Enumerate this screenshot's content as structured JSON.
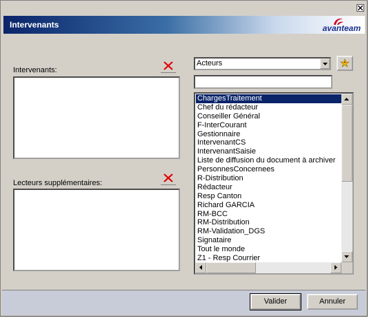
{
  "window": {
    "title": "Intervenants",
    "logo_text": "avanteam"
  },
  "left": {
    "intervenants_label": "Intervenants:",
    "lecteurs_label": "Lecteurs supplémentaires:",
    "intervenants_items": [],
    "lecteurs_items": []
  },
  "right": {
    "combo_value": "Acteurs",
    "filter_value": "",
    "selected_index": 0,
    "items": [
      "ChargesTraitement",
      "Chef du rédacteur",
      "Conseiller Général",
      "F-InterCourant",
      "Gestionnaire",
      "IntervenantCS",
      "IntervenantSaisie",
      "Liste de diffusion du document à archiver",
      "PersonnesConcernees",
      "R-Distribution",
      "Rédacteur",
      "Resp Canton",
      "Richard GARCIA",
      "RM-BCC",
      "RM-Distribution",
      "RM-Validation_DGS",
      "Signataire",
      "Tout le monde",
      "Z1 - Resp Courrier"
    ]
  },
  "buttons": {
    "ok": "Valider",
    "cancel": "Annuler"
  },
  "colors": {
    "selection": "#0a246a",
    "delete_red": "#e00000",
    "brand": "#1a2e8c"
  },
  "icons": {
    "close": "close-icon",
    "delete": "delete-x-icon",
    "add": "add-star-icon",
    "dropdown": "chevron-down-icon"
  }
}
